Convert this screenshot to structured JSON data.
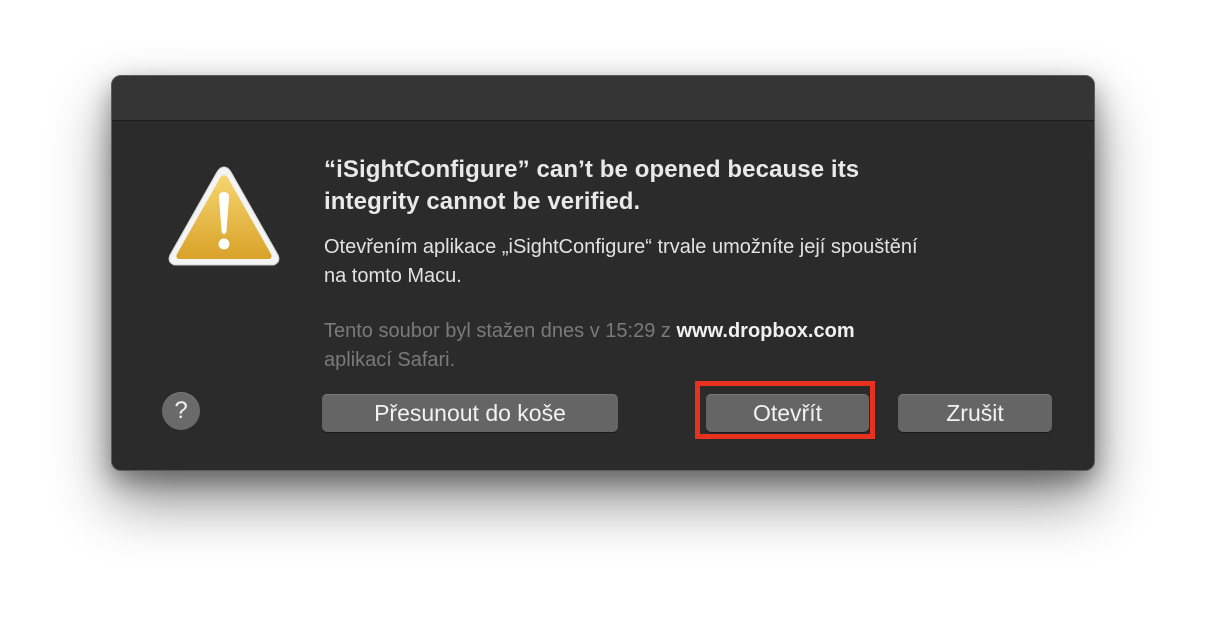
{
  "dialog": {
    "title_line1": "“iSightConfigure” can’t be opened because its",
    "title_line2": "integrity cannot be verified.",
    "message_line1": "Otevřením aplikace „iSightConfigure“ trvale umožníte její spouštění",
    "message_line2": "na tomto Macu.",
    "info_prefix": "Tento soubor byl stažen dnes v 15:29 z ",
    "info_domain": "www.dropbox.com",
    "info_line2": "aplikací Safari.",
    "icon": "warning-triangle-icon",
    "help_label": "?",
    "buttons": {
      "trash_label": "Přesunout do koše",
      "open_label": "Otevřít",
      "cancel_label": "Zrušit"
    }
  },
  "colors": {
    "dialog_background": "#2b2b2b",
    "button_background": "#656565",
    "warning_yellow": "#e8b53a",
    "highlight_red": "#e8321f"
  }
}
